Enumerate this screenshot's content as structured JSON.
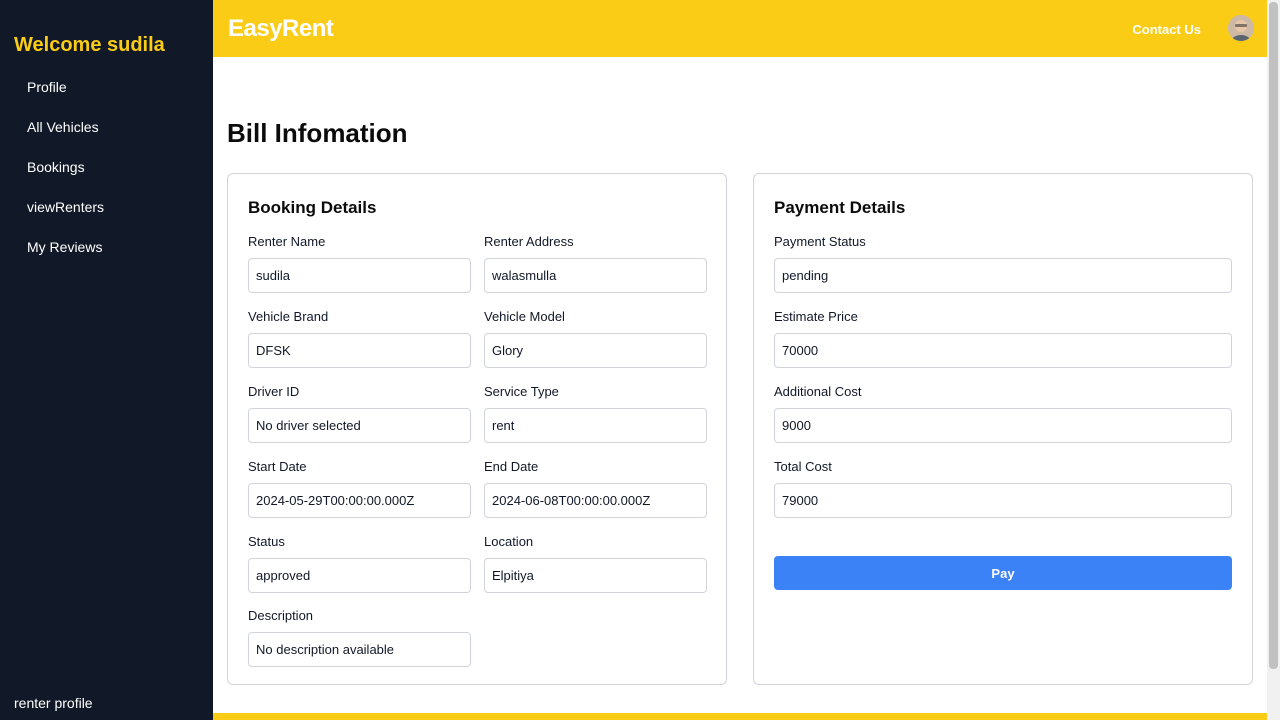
{
  "sidebar": {
    "welcome": "Welcome sudila",
    "items": [
      {
        "label": "Profile"
      },
      {
        "label": "All Vehicles"
      },
      {
        "label": "Bookings"
      },
      {
        "label": "viewRenters"
      },
      {
        "label": "My Reviews"
      }
    ],
    "footer_link": "renter profile"
  },
  "header": {
    "brand": "EasyRent",
    "contact": "Contact Us",
    "avatar_icon": "user-avatar"
  },
  "page": {
    "title": "Bill Infomation"
  },
  "booking": {
    "heading": "Booking Details",
    "renter_name": {
      "label": "Renter Name",
      "value": "sudila"
    },
    "renter_address": {
      "label": "Renter Address",
      "value": "walasmulla"
    },
    "vehicle_brand": {
      "label": "Vehicle Brand",
      "value": "DFSK"
    },
    "vehicle_model": {
      "label": "Vehicle Model",
      "value": "Glory"
    },
    "driver_id": {
      "label": "Driver ID",
      "value": "No driver selected"
    },
    "service_type": {
      "label": "Service Type",
      "value": "rent"
    },
    "start_date": {
      "label": "Start Date",
      "value": "2024-05-29T00:00:00.000Z"
    },
    "end_date": {
      "label": "End Date",
      "value": "2024-06-08T00:00:00.000Z"
    },
    "status": {
      "label": "Status",
      "value": "approved"
    },
    "location": {
      "label": "Location",
      "value": "Elpitiya"
    },
    "description": {
      "label": "Description",
      "value": "No description available"
    }
  },
  "payment": {
    "heading": "Payment Details",
    "payment_status": {
      "label": "Payment Status",
      "value": "pending"
    },
    "estimate_price": {
      "label": "Estimate Price",
      "value": "70000"
    },
    "additional_cost": {
      "label": "Additional Cost",
      "value": "9000"
    },
    "total_cost": {
      "label": "Total Cost",
      "value": "79000"
    },
    "pay_label": "Pay"
  },
  "colors": {
    "sidebar_bg": "#111827",
    "accent_yellow": "#facc15",
    "primary_blue": "#3b82f6"
  }
}
